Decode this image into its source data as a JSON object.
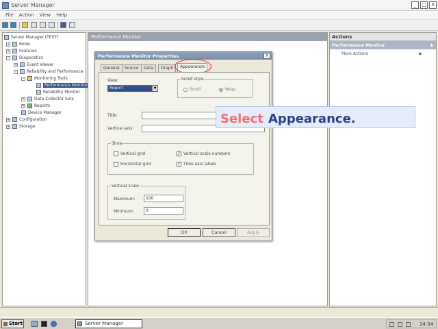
{
  "window": {
    "title": "Server Manager",
    "minimize": "_",
    "maximize": "□",
    "close": "X"
  },
  "menu": [
    "File",
    "Action",
    "View",
    "Help"
  ],
  "tree": [
    {
      "label": "Server Manager (TEST)",
      "exp": ""
    },
    {
      "label": "Roles",
      "exp": "+"
    },
    {
      "label": "Features",
      "exp": "+"
    },
    {
      "label": "Diagnostics",
      "exp": "-"
    },
    {
      "label": "Event Viewer",
      "exp": "+"
    },
    {
      "label": "Reliability and Performance",
      "exp": "-"
    },
    {
      "label": "Monitoring Tools",
      "exp": "-"
    },
    {
      "label": "Performance Monitor",
      "exp": ""
    },
    {
      "label": "Reliability Monitor",
      "exp": ""
    },
    {
      "label": "Data Collector Sets",
      "exp": "+"
    },
    {
      "label": "Reports",
      "exp": "+"
    },
    {
      "label": "Device Manager",
      "exp": ""
    },
    {
      "label": "Configuration",
      "exp": "+"
    },
    {
      "label": "Storage",
      "exp": "+"
    }
  ],
  "center": {
    "header": "Performance Monitor"
  },
  "actions": {
    "header": "Actions",
    "section": "Performance Monitor",
    "more": "More Actions",
    "caret_up": "▲",
    "caret_right": "▶"
  },
  "dialog": {
    "title": "Performance Monitor Properties",
    "close": "X",
    "tabs": [
      "General",
      "Source",
      "Data",
      "Graph",
      "Appearance"
    ],
    "view_label": "View:",
    "view_value": "Report",
    "view_arrow": "▼",
    "scroll_style_label": "Scroll style",
    "scroll_option_1": "Scroll",
    "scroll_option_2": "Wrap",
    "title_label": "Title:",
    "vaxis_label": "Vertical axis:",
    "show_label": "Show",
    "checks": [
      {
        "label": "Vertical grid",
        "mark": ""
      },
      {
        "label": "Vertical scale numbers",
        "mark": "✓"
      },
      {
        "label": "Horizontal grid",
        "mark": ""
      },
      {
        "label": "Time axis labels",
        "mark": "✓"
      }
    ],
    "vscale_label": "Vertical scale",
    "max_label": "Maximum:",
    "max_value": "100",
    "min_label": "Minimum:",
    "min_value": "0",
    "ok": "OK",
    "cancel": "Cancel",
    "apply": "Apply"
  },
  "callout": {
    "word1": "Select",
    "word2": "Appearance."
  },
  "taskbar": {
    "start": "Start",
    "task": "Server Manager",
    "clock": "14:34"
  }
}
